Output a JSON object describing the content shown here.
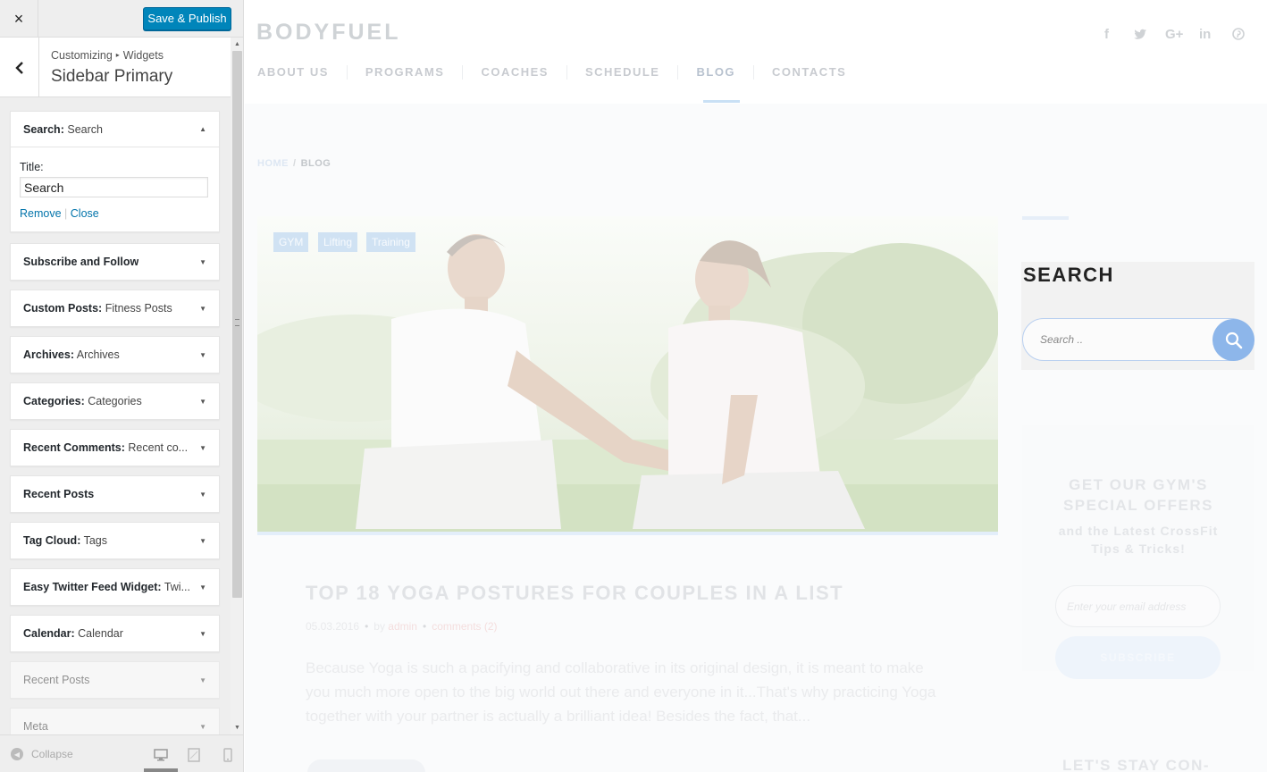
{
  "panel": {
    "close_icon": "×",
    "save_label": "Save & Publish",
    "crumb_parent": "Customizing",
    "crumb_section": "Widgets",
    "section_title": "Sidebar Primary",
    "widgets": [
      {
        "type": "Search",
        "name": "Search",
        "expanded": true
      },
      {
        "type": "Subscribe and Follow",
        "name": ""
      },
      {
        "type": "Custom Posts",
        "name": "Fitness Posts"
      },
      {
        "type": "Archives",
        "name": "Archives"
      },
      {
        "type": "Categories",
        "name": "Categories"
      },
      {
        "type": "Recent Comments",
        "name": "Recent co..."
      },
      {
        "type": "Recent Posts",
        "name": ""
      },
      {
        "type": "Tag Cloud",
        "name": "Tags"
      },
      {
        "type": "Easy Twitter Feed Widget",
        "name": "Twi..."
      },
      {
        "type": "Calendar",
        "name": "Calendar"
      },
      {
        "type": "Recent Posts",
        "name": ""
      },
      {
        "type": "Meta",
        "name": ""
      }
    ],
    "search_widget": {
      "title_label": "Title:",
      "title_value": "Search",
      "remove_label": "Remove",
      "divider": "|",
      "close_label": "Close"
    },
    "collapse_label": "Collapse"
  },
  "site": {
    "logo": "BODYFUEL",
    "nav": [
      "ABOUT US",
      "PROGRAMS",
      "COACHES",
      "SCHEDULE",
      "BLOG",
      "CONTACTS"
    ],
    "active_nav": "BLOG",
    "social_icons": [
      "facebook-icon",
      "twitter-icon",
      "google-plus-icon",
      "linkedin-icon",
      "pinterest-icon"
    ],
    "breadcrumb": {
      "home": "HOME",
      "sep": "/",
      "current": "BLOG"
    },
    "post": {
      "tags": [
        "GYM",
        "Lifting",
        "Training"
      ],
      "title": "TOP 18 YOGA POSTURES FOR COUPLES IN A LIST",
      "date": "05.03.2016",
      "by": "by",
      "author": "admin",
      "comments": "comments (2)",
      "excerpt": "Because Yoga is such a pacifying and collaborative in its original design, it is meant to make you much more open to the big world out there and everyone in it...That's why practicing Yoga together with your partner is actually a brilliant idea! Besides the fact, that..."
    },
    "sidebar": {
      "search_title": "SEARCH",
      "search_placeholder": "Search ..",
      "offer_heading_1": "GET OUR GYM'S",
      "offer_heading_2": "SPECIAL OFFERS",
      "offer_sub_1": "and the Latest CrossFit",
      "offer_sub_2": "Tips & Tricks!",
      "email_placeholder": "Enter your email address",
      "subscribe_label": "SUBSCRIBE",
      "stay_connected": "LET'S STAY CON-"
    }
  },
  "colors": {
    "accent_blue": "#0085ba",
    "link_blue": "#0073aa",
    "search_button": "#8db6ea"
  }
}
